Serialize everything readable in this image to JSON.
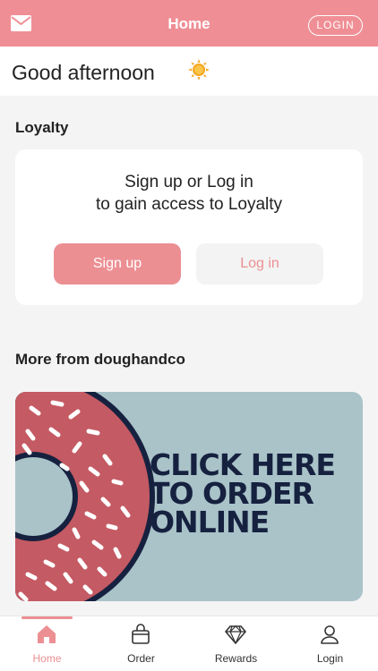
{
  "header": {
    "title": "Home",
    "login_label": "LOGIN",
    "mail_icon": "mail-icon"
  },
  "greeting": {
    "text": "Good afternoon",
    "icon": "sun-icon"
  },
  "loyalty": {
    "section_title": "Loyalty",
    "message_line1": "Sign up or Log in",
    "message_line2": "to gain access to Loyalty",
    "signup_label": "Sign up",
    "login_label": "Log in"
  },
  "more": {
    "section_title": "More from doughandco",
    "banner_line1": "CLICK HERE",
    "banner_line2": "TO ORDER",
    "banner_line3": "ONLINE"
  },
  "tabbar": {
    "items": [
      {
        "label": "Home",
        "icon": "home-icon",
        "active": true
      },
      {
        "label": "Order",
        "icon": "bag-icon",
        "active": false
      },
      {
        "label": "Rewards",
        "icon": "diamond-icon",
        "active": false
      },
      {
        "label": "Login",
        "icon": "person-icon",
        "active": false
      }
    ]
  },
  "colors": {
    "brand": "#ef8f95",
    "banner_bg": "#a9c3c9",
    "donut": "#c45a63",
    "navy": "#16213f"
  }
}
